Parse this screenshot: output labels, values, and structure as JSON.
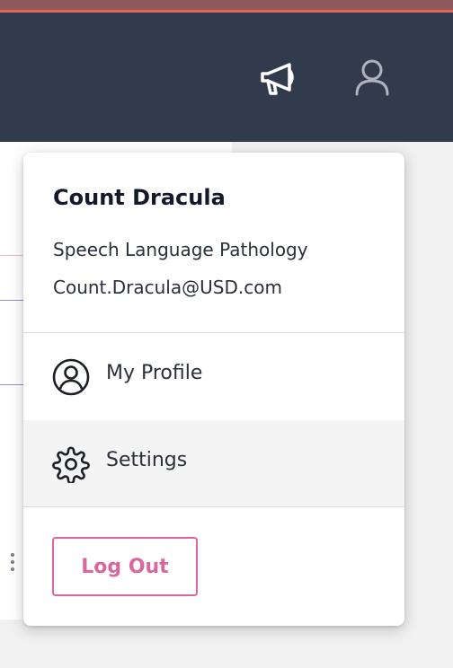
{
  "header": {
    "announcements_icon": "megaphone-icon",
    "user_icon": "user-icon"
  },
  "dropdown": {
    "user": {
      "name": "Count Dracula",
      "department": "Speech Language Pathology",
      "email": "Count.Dracula@USD.com"
    },
    "menu": [
      {
        "label": "My Profile",
        "icon": "user-circle-icon"
      },
      {
        "label": "Settings",
        "icon": "gear-icon",
        "highlighted": true
      }
    ],
    "logout_label": "Log Out"
  },
  "colors": {
    "header_bg": "#323b4b",
    "accent_pink": "#d9679f",
    "stripe": "#8c5a5a"
  }
}
